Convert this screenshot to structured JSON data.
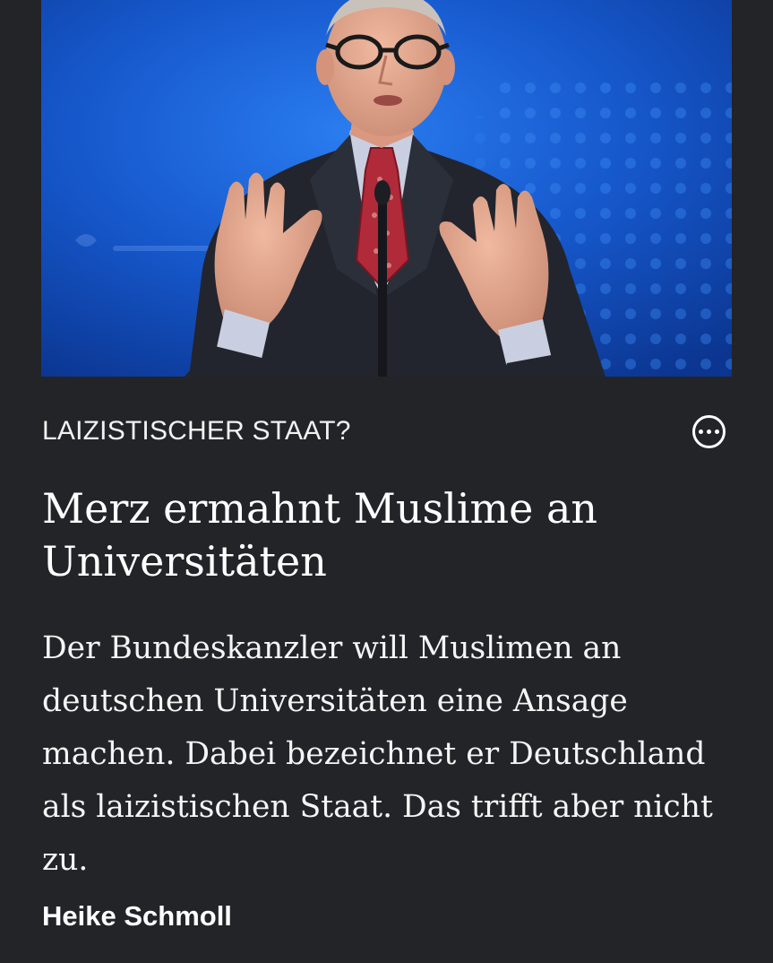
{
  "article": {
    "kicker": "LAIZISTISCHER STAAT?",
    "headline": "Merz ermahnt Muslime an Universitäten",
    "teaser": "Der Bundeskanzler will Muslimen an deutschen Universitäten eine Ansage machen. Dabei bezeichnet er Deutschland als laizistischen Staat. Das trifft aber nicht zu.",
    "author": "Heike Schmoll"
  },
  "icons": {
    "more": "more-options-icon"
  },
  "colors": {
    "background": "#222427",
    "text": "#ffffff",
    "photo_background": "#1452c4"
  }
}
